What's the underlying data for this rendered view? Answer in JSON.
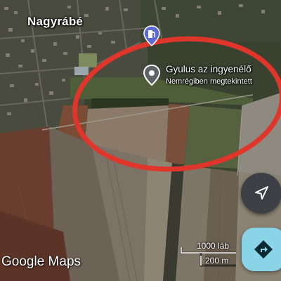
{
  "map": {
    "town_label": "Nagyrábé",
    "place": {
      "title": "Gyulus az ingyenélő",
      "subtitle": "Nemrégiben megtekintett"
    },
    "highlight_color": "#e0352b",
    "attribution": "Google Maps",
    "scale": {
      "top": "1000 láb",
      "bottom": "200 m"
    }
  },
  "icons": {
    "place_pin": "location-pin-icon",
    "poi_pin": "fuel-station-icon",
    "locate": "navigation-arrow-icon",
    "directions": "directions-icon"
  }
}
